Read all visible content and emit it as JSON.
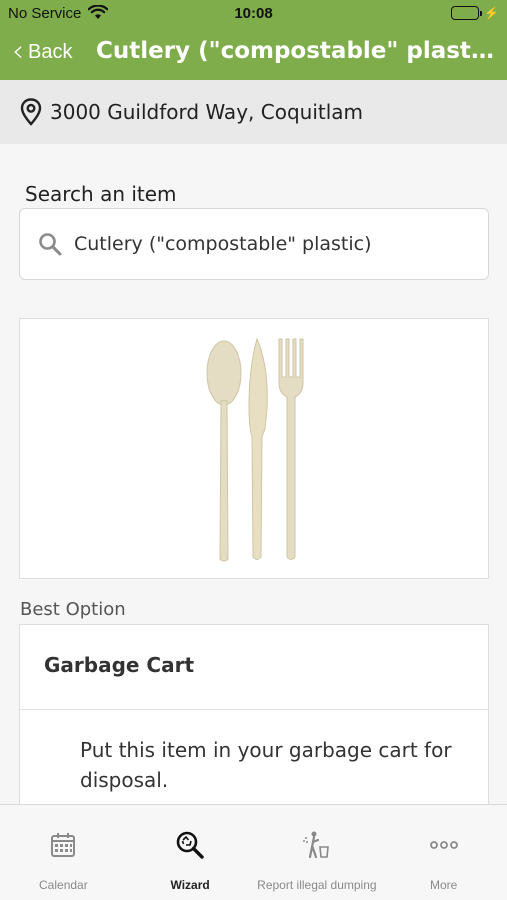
{
  "status_bar": {
    "carrier": "No Service",
    "time": "10:08",
    "wifi_icon": "wifi-icon",
    "battery_icon": "battery-charging-icon"
  },
  "nav": {
    "back_label": "Back",
    "title": "Cutlery (\"compostable\" plastic)"
  },
  "address": {
    "icon": "location-pin-icon",
    "text": "3000 Guildford Way, Coquitlam"
  },
  "search": {
    "label": "Search an item",
    "value": "Cutlery (\"compostable\" plastic)",
    "icon": "search-icon"
  },
  "item_image": {
    "icon": "cutlery-image"
  },
  "best_option": {
    "section_label": "Best Option",
    "title": "Garbage Cart",
    "description": "Put this item in your garbage cart for disposal."
  },
  "tabs": [
    {
      "label": "Calendar",
      "icon": "calendar-icon",
      "active": false
    },
    {
      "label": "Wizard",
      "icon": "wizard-search-icon",
      "active": true
    },
    {
      "label": "Report illegal dumping",
      "icon": "illegal-dumping-icon",
      "active": false
    },
    {
      "label": "More",
      "icon": "more-icon",
      "active": false
    }
  ],
  "colors": {
    "header_green": "#7fad4c",
    "address_bg": "#e9e9e9",
    "background": "#f6f6f6"
  }
}
